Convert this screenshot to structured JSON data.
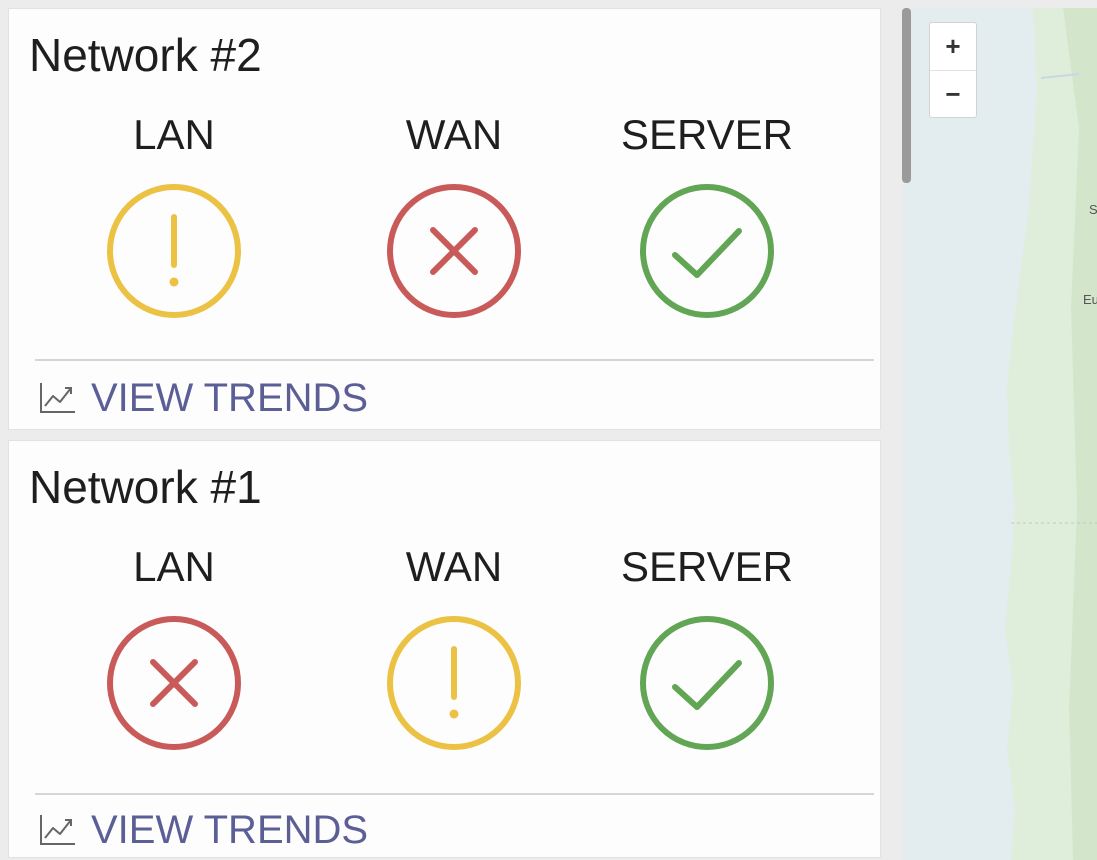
{
  "colors": {
    "warning": "#ecc244",
    "error": "#c95a5a",
    "ok": "#62a555",
    "link": "#5c5f95",
    "water": "#e3ecef",
    "land": "#dfeedb"
  },
  "networks": [
    {
      "title": "Network #2",
      "statuses": [
        {
          "label": "LAN",
          "state": "warning",
          "icon": "warning-icon"
        },
        {
          "label": "WAN",
          "state": "error",
          "icon": "error-x-icon"
        },
        {
          "label": "SERVER",
          "state": "ok",
          "icon": "checkmark-icon"
        }
      ],
      "trends_label": "VIEW TRENDS"
    },
    {
      "title": "Network #1",
      "statuses": [
        {
          "label": "LAN",
          "state": "error",
          "icon": "error-x-icon"
        },
        {
          "label": "WAN",
          "state": "warning",
          "icon": "warning-icon"
        },
        {
          "label": "SERVER",
          "state": "ok",
          "icon": "checkmark-icon"
        }
      ],
      "trends_label": "VIEW TRENDS"
    }
  ],
  "map": {
    "zoom_in_label": "+",
    "zoom_out_label": "−",
    "place_labels": [
      "S",
      "Eu"
    ]
  }
}
